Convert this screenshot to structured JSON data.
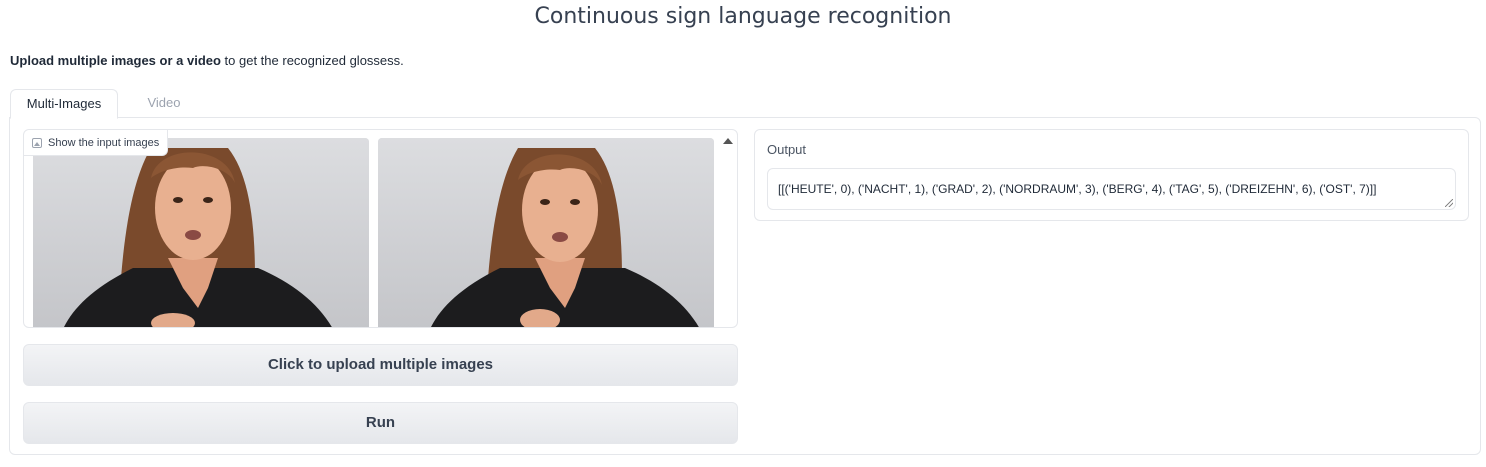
{
  "header": {
    "title": "Continuous sign language recognition",
    "subtitle_bold": "Upload multiple images or a video",
    "subtitle_rest": " to get the recognized glossess."
  },
  "tabs": [
    {
      "label": "Multi-Images",
      "active": true
    },
    {
      "label": "Video",
      "active": false
    }
  ],
  "gallery": {
    "label": "Show the input images",
    "images": [
      {
        "alt": "signer frame 1"
      },
      {
        "alt": "signer frame 2"
      }
    ]
  },
  "buttons": {
    "upload_label": "Click to upload multiple images",
    "run_label": "Run"
  },
  "output": {
    "label": "Output",
    "value": "[[('HEUTE', 0), ('NACHT', 1), ('GRAD', 2), ('NORDRAUM', 3), ('BERG', 4), ('TAG', 5), ('DREIZEHN', 6), ('OST', 7)]]"
  },
  "colors": {
    "border": "#e5e7eb",
    "button_bg": "#e5e7eb",
    "text": "#1f2937"
  }
}
